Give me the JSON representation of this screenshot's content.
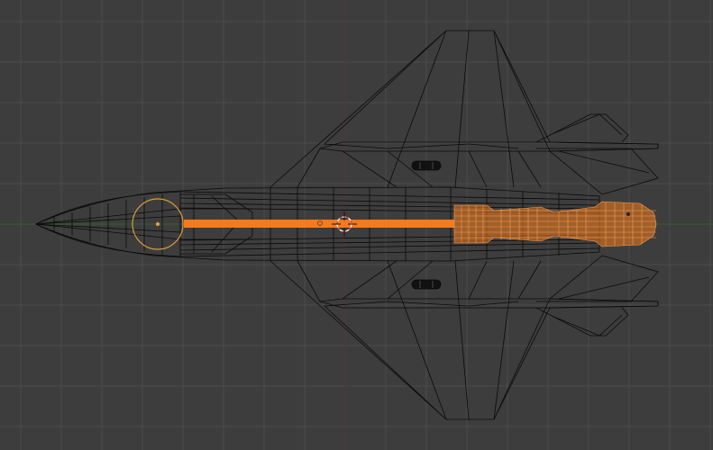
{
  "viewport": {
    "view": "top-orthographic",
    "shading": "wireframe",
    "object": "jet-fighter-model"
  },
  "colors": {
    "background": "#3d3d3d",
    "grid": "#4c4c4c",
    "wire": "#0a0a0a",
    "selected": "#f47a1c",
    "axis_x": "#3a5a32",
    "axis_y": "#5c3232",
    "cursor_red": "#d84b3c",
    "cursor_white": "#eeeeee"
  },
  "icons": [
    "3d-cursor-icon",
    "object-origin-icon",
    "empty-circle-icon"
  ]
}
